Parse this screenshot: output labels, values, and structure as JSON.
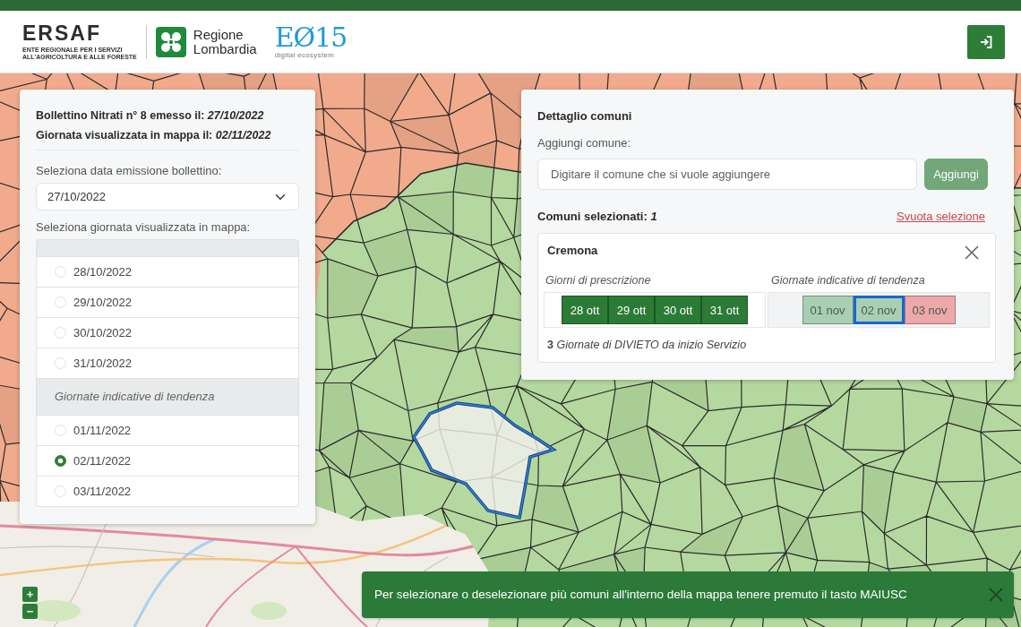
{
  "header": {
    "logos": [
      {
        "kind": "ersaf",
        "name": "ERSAF",
        "tagline_lines": [
          "ENTE REGIONALE PER I SERVIZI",
          "ALL'AGRICOLTURA E ALLE FORESTE"
        ]
      },
      {
        "kind": "region",
        "name_lines": [
          "Regione",
          "Lombardia"
        ]
      },
      {
        "kind": "e015",
        "name": "EØ15",
        "tagline": "digital ecosystem"
      }
    ]
  },
  "map": {
    "zoom_controls": [
      "+",
      "−"
    ]
  },
  "left_panel": {
    "heading_lines": [
      "Bollettino Nitrati n° 8 emesso il: *27/10/2022*",
      "Giornata visualizzata in mappa il: *02/11/2022*"
    ],
    "issue_label": "Seleziona data emissione bollettino:",
    "issue_select": {
      "value": "27/10/2022"
    },
    "day_label": "Seleziona giornata visualizzata in mappa:",
    "day_groups": [
      {
        "kind": "prescription",
        "options": [
          {
            "label": "28/10/2022",
            "selected": false
          },
          {
            "label": "29/10/2022",
            "selected": false
          },
          {
            "label": "30/10/2022",
            "selected": false
          },
          {
            "label": "31/10/2022",
            "selected": false
          }
        ]
      },
      {
        "kind": "trend",
        "header": "Giornate indicative di tendenza",
        "options": [
          {
            "label": "01/11/2022",
            "selected": false
          },
          {
            "label": "02/11/2022",
            "selected": true
          },
          {
            "label": "03/11/2022",
            "selected": false
          }
        ]
      }
    ]
  },
  "right_panel": {
    "title": "Dettaglio comuni",
    "add_label": "Aggiungi comune:",
    "add_field": {
      "placeholder": "Digitare il comune che si vuole aggiungere"
    },
    "add_button": {
      "label": "Aggiungi",
      "disabled": true
    },
    "selected_count": "Comuni selezionati: *1*",
    "clear_link": "Svuota selezione",
    "municipalities": [
      {
        "name": "Cremona",
        "prescription_label": "Giorni di prescrizione",
        "trend_label": "Giornate indicative di tendenza",
        "prescription_days": [
          {
            "label": "28 ott",
            "color": "#2b7a36"
          },
          {
            "label": "29 ott",
            "color": "#2b7a36"
          },
          {
            "label": "30 ott",
            "color": "#2b7a36"
          },
          {
            "label": "31 ott",
            "color": "#2b7a36"
          }
        ],
        "trend_days": [
          {
            "label": "01 nov",
            "color": "#a9cfb3",
            "selected": false
          },
          {
            "label": "02 nov",
            "color": "#a9cfb3",
            "selected": true
          },
          {
            "label": "03 nov",
            "color": "#eda8aa",
            "selected": false
          }
        ],
        "ban_summary": "**3** *Giornate di DIVIETO da inizio Servizio*"
      }
    ]
  },
  "toast": {
    "message": "Per selezionare o deselezionare più comuni all'interno della mappa tenere premuto il tasto MAIUSC"
  }
}
